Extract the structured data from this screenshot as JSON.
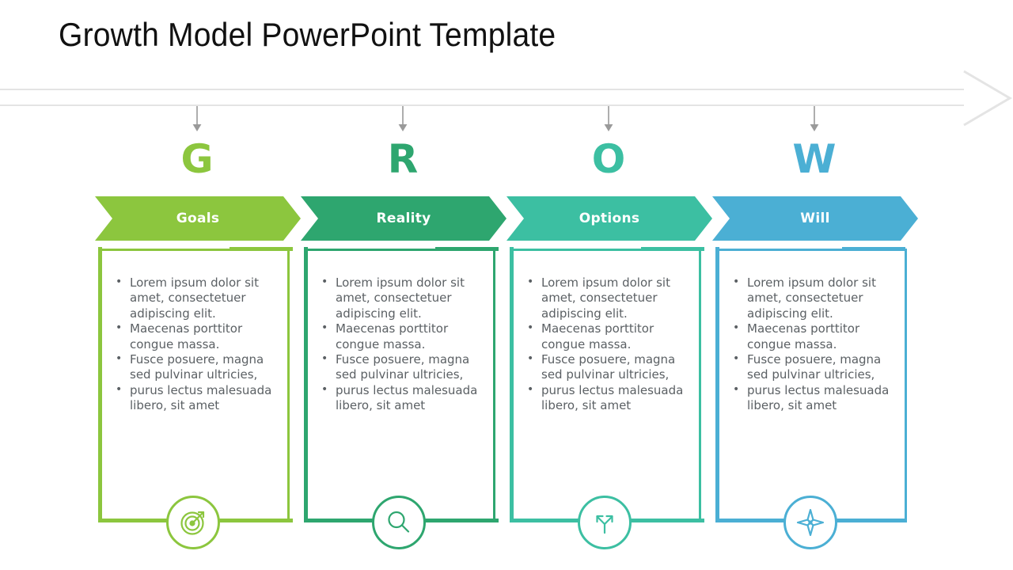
{
  "slide": {
    "title": "Growth Model PowerPoint Template"
  },
  "timeline": {
    "arrow_icon": "chevron-right-outline-icon",
    "arrow_color": "#e4e4e4",
    "connector_icon": "arrow-down-icon",
    "connector_color": "#9a9a9a"
  },
  "bullet_items": [
    "Lorem ipsum dolor sit amet, consectetuer adipiscing elit.",
    "Maecenas porttitor congue massa.",
    "Fusce posuere, magna sed pulvinar ultricies,",
    "purus lectus malesuada libero, sit amet"
  ],
  "columns": [
    {
      "letter": "G",
      "label": "Goals",
      "color": "#8CC63E",
      "letter_color": "#8CC63E",
      "icon": "target-bullseye-icon"
    },
    {
      "letter": "R",
      "label": "Reality",
      "color": "#2EA66F",
      "letter_color": "#2EA66F",
      "icon": "magnifying-glass-icon"
    },
    {
      "letter": "O",
      "label": "Options",
      "color": "#3CBFA2",
      "letter_color": "#3CBFA2",
      "icon": "fork-in-road-icon"
    },
    {
      "letter": "W",
      "label": "Will",
      "color": "#4BAFD4",
      "letter_color": "#4BAFD4",
      "icon": "compass-rose-icon"
    }
  ]
}
